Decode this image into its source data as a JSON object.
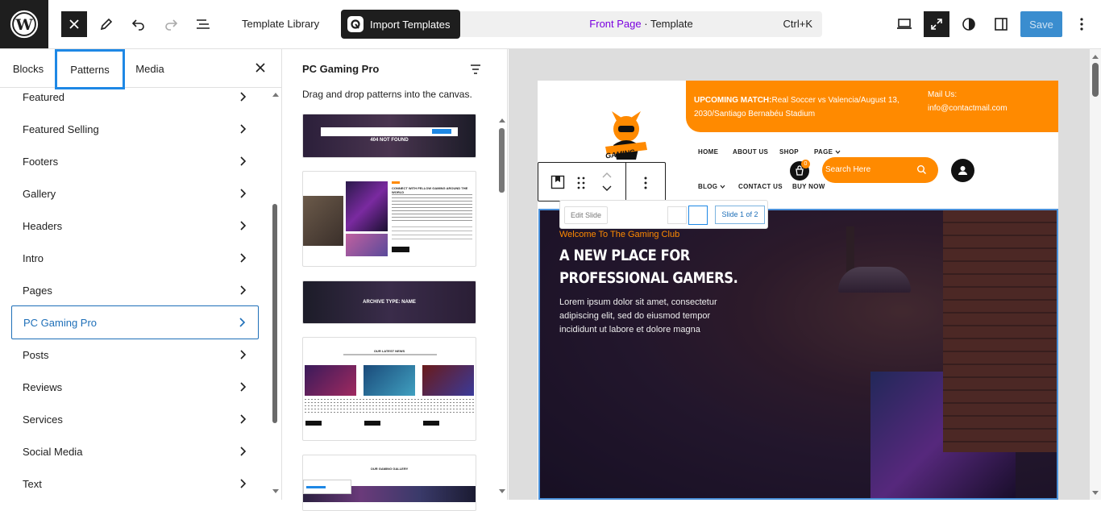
{
  "topbar": {
    "template_library": "Template Library",
    "import_templates": "Import Templates",
    "command": {
      "page": "Front Page",
      "separator": " · ",
      "type": "Template",
      "shortcut": "Ctrl+K"
    },
    "save": "Save"
  },
  "inserter": {
    "tabs": [
      "Blocks",
      "Patterns",
      "Media"
    ],
    "active_tab": "Patterns",
    "categories": [
      "Featured",
      "Featured Selling",
      "Footers",
      "Gallery",
      "Headers",
      "Intro",
      "Pages",
      "PC Gaming Pro",
      "Posts",
      "Reviews",
      "Services",
      "Social Media",
      "Text"
    ],
    "active_category": "PC Gaming Pro"
  },
  "patterns_panel": {
    "title": "PC Gaming Pro",
    "description": "Drag and drop patterns into the canvas.",
    "previews": [
      {
        "label": "404 NOT FOUND"
      },
      {
        "label": "CONNECT WITH FELLOW GAMING AROUND THE WORLD"
      },
      {
        "label": "ARCHIVE TYPE: NAME"
      },
      {
        "label": "OUR LATEST NEWS"
      },
      {
        "label": "OUR GAMING GALLERY"
      }
    ]
  },
  "canvas": {
    "topbar": {
      "match_label": "UPCOMING MATCH:",
      "match_text": "Real Soccer vs Valencia/August 13, 2030/Santiago Bernabéu Stadium",
      "mail_label": "Mail Us:",
      "mail_value": "info@contactmail.com"
    },
    "logo_text": "GAMING",
    "nav": [
      "HOME",
      "ABOUT US",
      "SHOP",
      "PAGE",
      "BLOG",
      "CONTACT US",
      "BUY NOW"
    ],
    "cart_count": "0",
    "search_placeholder": "Search Here",
    "slider": {
      "edit_label": "Edit Slide",
      "counter": "Slide 1 of 2",
      "kicker": "Welcome To The Gaming Club",
      "title": "A NEW PLACE FOR PROFESSIONAL GAMERS.",
      "body": "Lorem ipsum dolor sit amet, consectetur adipiscing elit, sed do eiusmod tempor incididunt ut labore et dolore magna"
    }
  },
  "colors": {
    "accent": "#ff8a00",
    "link": "#7a00df",
    "primary": "#3a8dcf",
    "focus": "#1e88e5"
  }
}
